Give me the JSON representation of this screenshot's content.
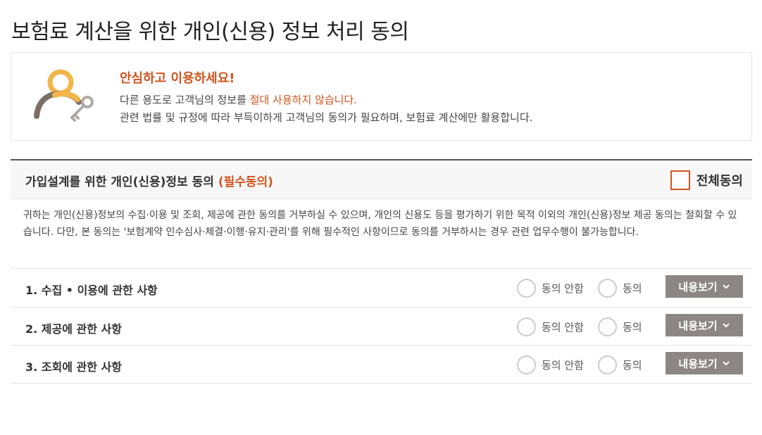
{
  "page": {
    "title": "보험료 계산을 위한 개인(신용) 정보 처리 동의"
  },
  "notice": {
    "icon": "user-key-icon",
    "heading": "안심하고 이용하세요!",
    "line1_prefix": "다른 용도로 고객님의 정보를 ",
    "line1_highlight": "절대 사용하지 않습니다.",
    "line2": "관련 법률 및 규정에 따라 부득이하게 고객님의 동의가 필요하며, 보험료 계산에만 활용합니다."
  },
  "section": {
    "title_prefix": "가입설계를 위한 개인(신용)정보 동의 ",
    "title_required": "(필수동의)",
    "all_agree_label": "전체동의",
    "all_agree_checked": false,
    "description": "귀하는 개인(신용)정보의 수집·이용 및 조회, 제공에 관한 동의를 거부하실 수 있으며, 개인의 신용도 등을 평가하기 위한 목적 이외의 개인(신용)정보 제공 동의는 철회할 수 있습니다. 다만, 본 동의는 '보험계약 인수심사·체결·이행·유지·관리'를 위해 필수적인 사항이므로 동의를 거부하시는 경우 관련 업무수행이 불가능합니다.",
    "rows": [
      {
        "label": "1. 수집 • 이용에 관한 사항",
        "disagree_label": "동의 안함",
        "agree_label": "동의",
        "view_label": "내용보기"
      },
      {
        "label": "2. 제공에 관한 사항",
        "disagree_label": "동의 안함",
        "agree_label": "동의",
        "view_label": "내용보기"
      },
      {
        "label": "3. 조회에 관한 사항",
        "disagree_label": "동의 안함",
        "agree_label": "동의",
        "view_label": "내용보기"
      }
    ]
  },
  "colors": {
    "accent": "#d2541e",
    "button_bg": "#8c8784",
    "header_border": "#555555"
  }
}
